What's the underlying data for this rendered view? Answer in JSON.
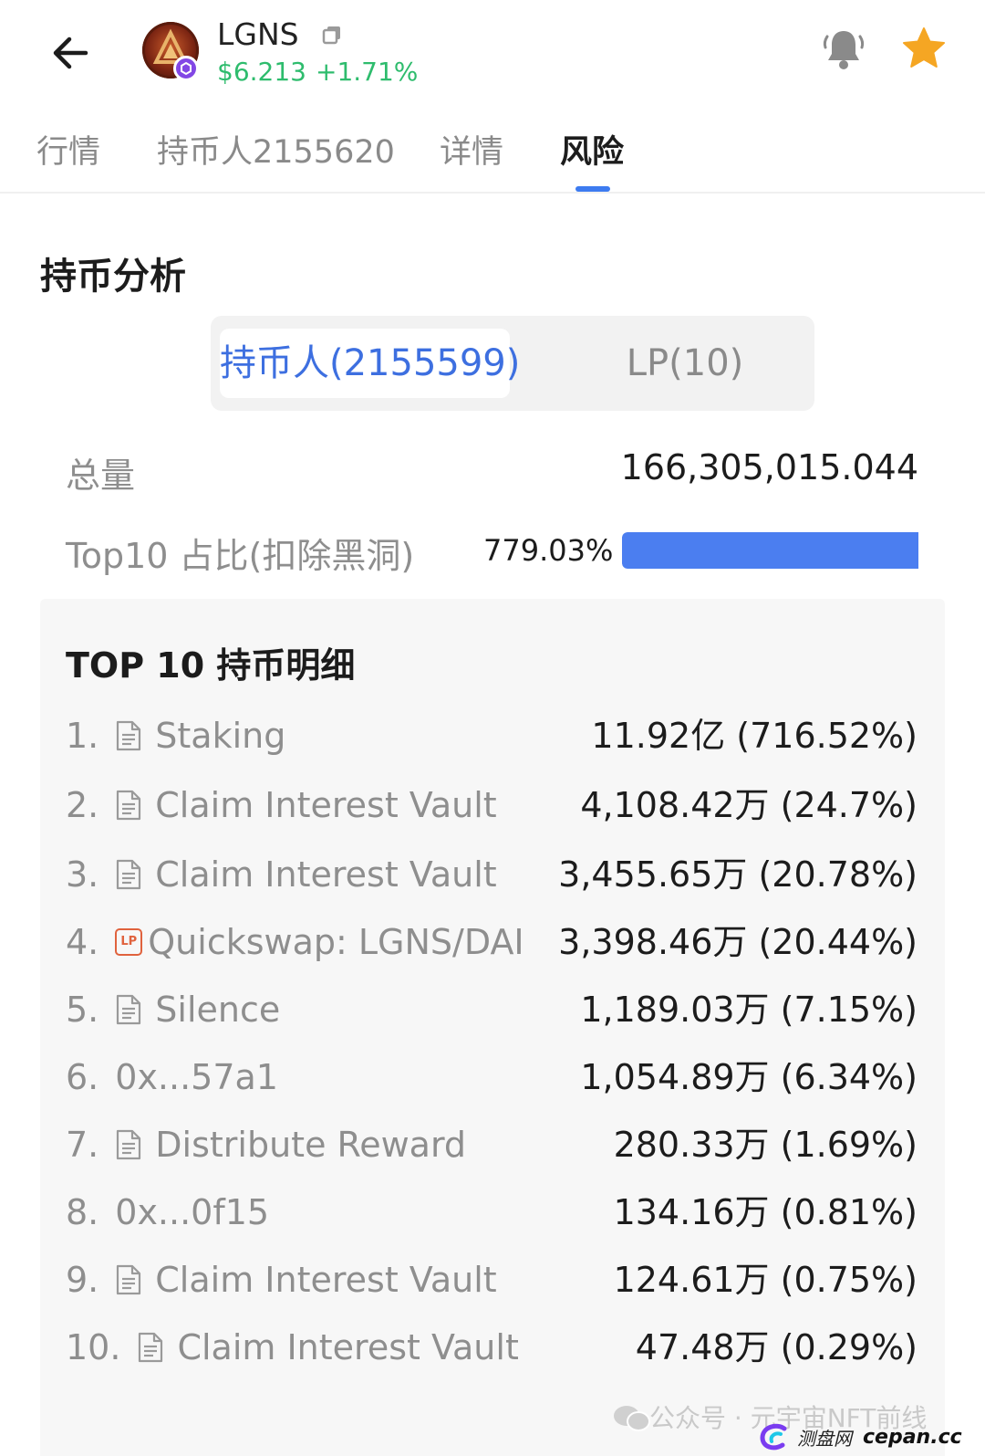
{
  "header": {
    "token_symbol": "LGNS",
    "price": "$6.213",
    "change": "+1.71%",
    "price_color": "#2ebc6d"
  },
  "tabs": [
    {
      "label": "行情"
    },
    {
      "label": "持币人2155620"
    },
    {
      "label": "详情"
    },
    {
      "label": "风险",
      "active": true
    }
  ],
  "section": {
    "title": "持币分析"
  },
  "segmented": {
    "holders_label": "持币人(2155599)",
    "lp_label": "LP(10)"
  },
  "stats": {
    "total_label": "总量",
    "total_value": "166,305,015.044",
    "top10_label": "Top10 占比(扣除黑洞)",
    "top10_value": "779.03%",
    "top10_bar_fill_fraction": 1.0
  },
  "top10": {
    "title": "TOP 10 持币明细",
    "rows": [
      {
        "rank": "1.",
        "name": "Staking",
        "icon": "document-icon",
        "amount": "11.92亿 (716.52%)"
      },
      {
        "rank": "2.",
        "name": "Claim Interest Vault",
        "icon": "document-icon",
        "amount": "4,108.42万 (24.7%)"
      },
      {
        "rank": "3.",
        "name": "Claim Interest Vault",
        "icon": "document-icon",
        "amount": "3,455.65万 (20.78%)"
      },
      {
        "rank": "4.",
        "name": "Quickswap: LGNS/DAI",
        "icon": "lp-icon",
        "icon_text": "LP",
        "amount": "3,398.46万 (20.44%)"
      },
      {
        "rank": "5.",
        "name": "Silence",
        "icon": "document-icon",
        "amount": "1,189.03万 (7.15%)"
      },
      {
        "rank": "6.",
        "name": "0x...57a1",
        "icon": "",
        "amount": "1,054.89万 (6.34%)"
      },
      {
        "rank": "7.",
        "name": "Distribute Reward",
        "icon": "document-icon",
        "amount": "280.33万 (1.69%)"
      },
      {
        "rank": "8.",
        "name": "0x...0f15",
        "icon": "",
        "amount": "134.16万 (0.81%)"
      },
      {
        "rank": "9.",
        "name": "Claim Interest Vault",
        "icon": "document-icon",
        "amount": "124.61万 (0.75%)"
      },
      {
        "rank": "10.",
        "name": "Claim Interest Vault",
        "icon": "document-icon",
        "amount": "47.48万 (0.29%)"
      }
    ]
  },
  "watermark": {
    "text": "公众号 · 元宇宙NFT前线",
    "site_cn": "测盘网",
    "site_en": "cepan.cc"
  },
  "colors": {
    "accent": "#3d7bf0",
    "bar": "#4b7ef0",
    "star": "#f5a623",
    "lp_badge": "#e0623d"
  }
}
